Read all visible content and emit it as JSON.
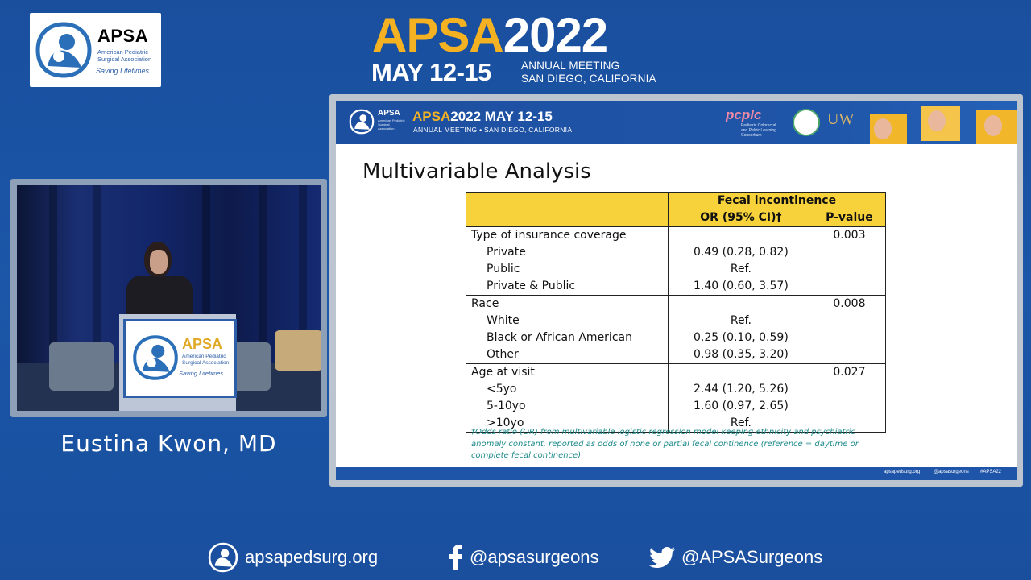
{
  "conference": {
    "logo_title": "APSA",
    "logo_subtitle": "American Pediatric Surgical Association",
    "logo_tagline": "Saving Lifetimes",
    "title_left": "APSA",
    "title_year": "2022",
    "dates": "MAY 12-15",
    "meeting_line1": "ANNUAL MEETING",
    "meeting_line2": "SAN DIEGO, CALIFORNIA"
  },
  "speaker": {
    "name": "Eustina Kwon, MD"
  },
  "slide": {
    "banner": {
      "apsa": "APSA",
      "apsa_sub": "American Pediatric Surgical Association",
      "title_left": "APSA",
      "title_right": "2022  MAY 12-15",
      "meeting": "ANNUAL MEETING • SAN DIEGO, CALIFORNIA",
      "pcplc": "pcplc",
      "pcplc_sub": "Pediatric Colorectal and Pelvic Learning Consortium",
      "uw": "UW"
    },
    "heading": "Multivariable Analysis",
    "table": {
      "header_group": "Fecal incontinence",
      "col_or": "OR (95% CI)†",
      "col_p": "P-value",
      "groups": [
        {
          "label": "Type of insurance coverage",
          "p": "0.003",
          "rows": [
            {
              "label": "Private",
              "or": "0.49 (0.28, 0.82)"
            },
            {
              "label": "Public",
              "or": "Ref."
            },
            {
              "label": "Private & Public",
              "or": "1.40 (0.60, 3.57)"
            }
          ]
        },
        {
          "label": "Race",
          "p": "0.008",
          "rows": [
            {
              "label": "White",
              "or": "Ref."
            },
            {
              "label": "Black or African American",
              "or": "0.25 (0.10, 0.59)"
            },
            {
              "label": "Other",
              "or": "0.98 (0.35, 3.20)"
            }
          ]
        },
        {
          "label": "Age at visit",
          "p": "0.027",
          "rows": [
            {
              "label": "<5yo",
              "or": "2.44 (1.20, 5.26)"
            },
            {
              "label": "5-10yo",
              "or": "1.60 (0.97, 2.65)"
            },
            {
              "label": ">10yo",
              "or": "Ref."
            }
          ]
        }
      ]
    },
    "footnote": "†Odds ratio (OR) from multivariable logistic regression model keeping ethnicity and psychiatric anomaly constant, reported as odds of none or partial fecal continence (reference = daytime or complete fecal continence)",
    "footer": {
      "site": "apsapedsurg.org",
      "social": "@apsasurgeons",
      "hashtag": "#APSA22"
    }
  },
  "bottom_bar": {
    "website": "apsapedsurg.org",
    "facebook": "@apsasurgeons",
    "twitter": "@APSASurgeons"
  },
  "colors": {
    "background": "#1b56a8",
    "accent_yellow": "#f4b223",
    "table_header": "#f7d23a",
    "footnote": "#1e8a8a"
  }
}
